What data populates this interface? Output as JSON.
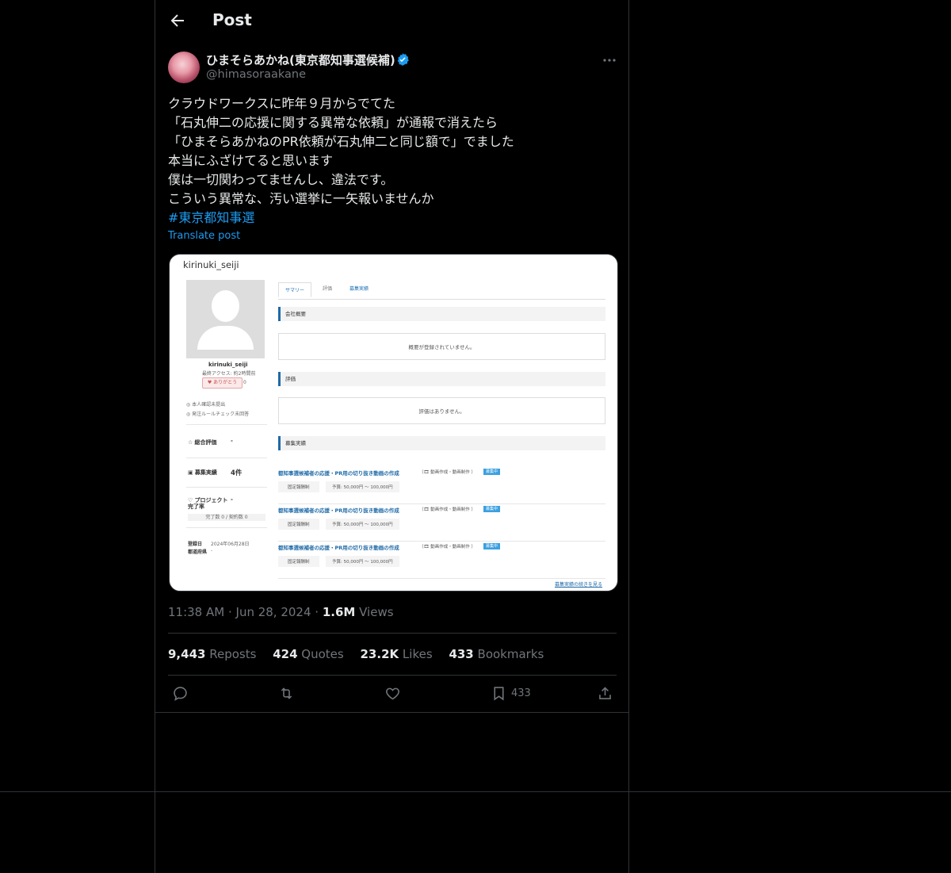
{
  "header": {
    "title": "Post"
  },
  "author": {
    "name": "ひまそらあかね(東京都知事選候補)",
    "handle": "@himasoraakane"
  },
  "tweet": {
    "lines": [
      "クラウドワークスに昨年９月からでてた",
      "「石丸伸二の応援に関する異常な依頼」が通報で消えたら",
      "「ひまそらあかねのPR依頼が石丸伸二と同じ額で」でました",
      "本当にふざけてると思います",
      "僕は一切関わってませんし、違法です。",
      "こういう異常な、汚い選挙に一矢報いませんか"
    ],
    "hashtag": "#東京都知事選",
    "translate": "Translate post"
  },
  "media": {
    "username": "kirinuki_seiji",
    "profile_name": "kirinuki_seiji",
    "last_access": "最終アクセス: 約2時間前",
    "thanks": "ありがとう",
    "thanks_count": "0",
    "id_status": "本人確認未提出",
    "rule_status": "発注ルールチェック未回答",
    "rating_label": "総合評価",
    "rating_value": "-",
    "jobs_label": "募集実績",
    "jobs_value": "4件",
    "project_label": "プロジェクト完了率",
    "project_value": "-",
    "project_detail": "完了数 0 / 契約数 0",
    "registered_label": "登録日",
    "registered_value": "2024年06月28日",
    "prefecture_label": "都道府県",
    "prefecture_value": "-",
    "tabs": [
      "サマリー",
      "評価",
      "募集実績"
    ],
    "company_section": "会社概要",
    "company_empty": "概要が登録されていません。",
    "review_section": "評価",
    "review_empty": "評価はありません。",
    "jobs_section": "募集実績",
    "jobs": [
      {
        "title": "都知事選候補者の応援・PR用の切り抜き動画の作成",
        "category": "（🎞 動画作成・動画制作 ）",
        "badge": "募集中",
        "type": "固定報酬制",
        "budget": "予算: 50,000円 〜 100,000円"
      },
      {
        "title": "都知事選候補者の応援・PR用の切り抜き動画の作成",
        "category": "（🎞 動画作成・動画制作 ）",
        "badge": "募集中",
        "type": "固定報酬制",
        "budget": "予算: 50,000円 〜 100,000円"
      },
      {
        "title": "都知事選候補者の応援・PR用の切り抜き動画の作成",
        "category": "（🎞 動画作成・動画制作 ）",
        "badge": "募集中",
        "type": "固定報酬制",
        "budget": "予算: 50,000円 〜 100,000円"
      }
    ],
    "more_link": "募集実績の続きを見る"
  },
  "meta": {
    "time": "11:38 AM",
    "date": "Jun 28, 2024",
    "views_count": "1.6M",
    "views_label": "Views"
  },
  "stats": {
    "reposts": "9,443",
    "reposts_label": "Reposts",
    "quotes": "424",
    "quotes_label": "Quotes",
    "likes": "23.2K",
    "likes_label": "Likes",
    "bookmarks": "433",
    "bookmarks_label": "Bookmarks"
  },
  "actions": {
    "bookmark_count": "433"
  },
  "icons": [
    "back-arrow-icon",
    "verified-badge-icon",
    "more-icon",
    "reply-icon",
    "repost-icon",
    "like-icon",
    "bookmark-icon",
    "share-icon"
  ],
  "colors": {
    "background": "#000000",
    "text": "#e7e9ea",
    "muted": "#71767b",
    "accent": "#1d9bf0",
    "border": "#2f3336"
  }
}
